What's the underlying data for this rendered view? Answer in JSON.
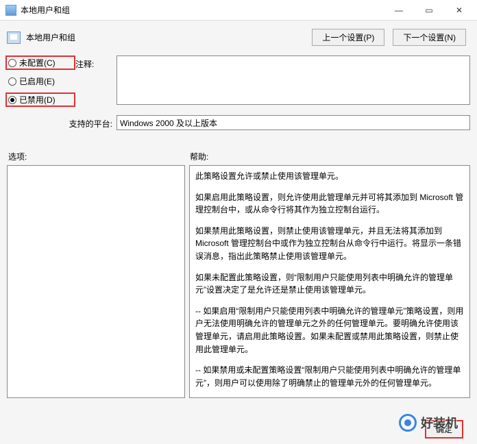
{
  "window": {
    "title": "本地用户和组"
  },
  "header": {
    "title": "本地用户和组",
    "prev_btn": "上一个设置(P)",
    "next_btn": "下一个设置(N)"
  },
  "radios": {
    "not_configured": "未配置(C)",
    "enabled": "已启用(E)",
    "disabled": "已禁用(D)"
  },
  "labels": {
    "comment": "注释:",
    "platform": "支持的平台:",
    "options": "选项:",
    "help": "帮助:"
  },
  "platform_value": "Windows 2000 及以上版本",
  "help_paras": [
    "此策略设置允许或禁止使用该管理单元。",
    "如果启用此策略设置，则允许使用此管理单元并可将其添加到 Microsoft 管理控制台中，或从命令行将其作为独立控制台运行。",
    "如果禁用此策略设置，则禁止使用该管理单元，并且无法将其添加到 Microsoft 管理控制台中或作为独立控制台从命令行中运行。将显示一条错误消息，指出此策略禁止使用该管理单元。",
    "如果未配置此策略设置，则“限制用户只能使用列表中明确允许的管理单元”设置决定了是允许还是禁止使用该管理单元。",
    "--  如果启用“限制用户只能使用列表中明确允许的管理单元”策略设置，则用户无法使用明确允许的管理单元之外的任何管理单元。要明确允许使用该管理单元，请启用此策略设置。如果未配置或禁用此策略设置，则禁止使用此管理单元。",
    "--  如果禁用或未配置策略设置“限制用户只能使用列表中明确允许的管理单元”，则用户可以使用除了明确禁止的管理单元外的任何管理单元。"
  ],
  "footer": {
    "ok": "确定"
  },
  "watermark": "好装机"
}
